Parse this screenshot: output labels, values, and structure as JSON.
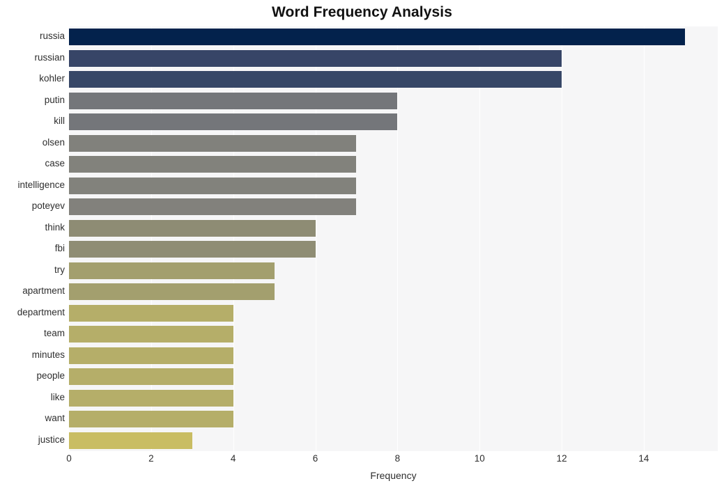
{
  "chart_data": {
    "type": "bar",
    "orientation": "horizontal",
    "title": "Word Frequency Analysis",
    "xlabel": "Frequency",
    "ylabel": "",
    "categories": [
      "russia",
      "russian",
      "kohler",
      "putin",
      "kill",
      "olsen",
      "case",
      "intelligence",
      "poteyev",
      "think",
      "fbi",
      "try",
      "apartment",
      "department",
      "team",
      "minutes",
      "people",
      "like",
      "want",
      "justice"
    ],
    "values": [
      15,
      12,
      12,
      8,
      8,
      7,
      7,
      7,
      7,
      6,
      6,
      5,
      5,
      4,
      4,
      4,
      4,
      4,
      4,
      3
    ],
    "bar_colors": [
      "#03224c",
      "#374567",
      "#374767",
      "#74767a",
      "#74767a",
      "#81817c",
      "#82827c",
      "#82827c",
      "#82817c",
      "#8e8c74",
      "#8f8d74",
      "#a39f6e",
      "#a39f6e",
      "#b5ae69",
      "#b5ae69",
      "#b5ae69",
      "#b5ae69",
      "#b5ae69",
      "#b5ae69",
      "#c9bd63"
    ],
    "xlim": [
      0,
      15.8
    ],
    "xticks": [
      0,
      2,
      4,
      6,
      8,
      10,
      12,
      14
    ],
    "xtick_labels": [
      "0",
      "2",
      "4",
      "6",
      "8",
      "10",
      "12",
      "14"
    ],
    "grid": true,
    "grid_color": "#ffffff",
    "plot_background": "#f6f6f7",
    "figure_background": "#ffffff",
    "legend": null
  }
}
